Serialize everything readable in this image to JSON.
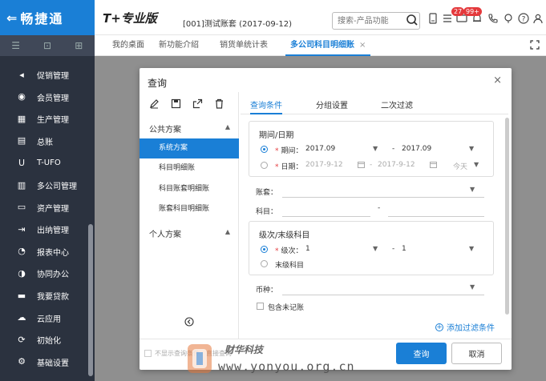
{
  "brand": {
    "glyph": "⇐",
    "name": "畅捷通"
  },
  "product": "T+专业版",
  "account": "[001]测试账套  (2017-09-12)",
  "search": {
    "placeholder": "搜索-产品功能"
  },
  "badges": {
    "messages": "27",
    "notices": "99+"
  },
  "tabs": [
    {
      "label": "我的桌面"
    },
    {
      "label": "新功能介绍"
    },
    {
      "label": "销货单统计表"
    },
    {
      "label": "多公司科目明细账",
      "close": "×"
    }
  ],
  "sidebar": {
    "items": [
      {
        "label": "促销管理",
        "icon": "megaphone-icon"
      },
      {
        "label": "会员管理",
        "icon": "member-icon"
      },
      {
        "label": "生产管理",
        "icon": "production-icon"
      },
      {
        "label": "总账",
        "icon": "ledger-icon"
      },
      {
        "label": "T-UFO",
        "icon": "ufo-icon"
      },
      {
        "label": "多公司管理",
        "icon": "company-icon"
      },
      {
        "label": "资产管理",
        "icon": "asset-icon"
      },
      {
        "label": "出纳管理",
        "icon": "cashier-icon"
      },
      {
        "label": "报表中心",
        "icon": "report-icon"
      },
      {
        "label": "协同办公",
        "icon": "collab-icon"
      },
      {
        "label": "我要贷款",
        "icon": "loan-icon"
      },
      {
        "label": "云应用",
        "icon": "cloud-icon"
      },
      {
        "label": "初始化",
        "icon": "init-icon"
      },
      {
        "label": "基础设置",
        "icon": "settings-icon"
      }
    ]
  },
  "dialog": {
    "title": "查询",
    "close": "×",
    "public_scheme": "公共方案",
    "schemes": [
      "系统方案",
      "科目明细账",
      "科目账套明细账",
      "账套科目明细账"
    ],
    "personal_scheme": "个人方案",
    "tabs": [
      "查询条件",
      "分组设置",
      "二次过滤"
    ],
    "period_section": {
      "title": "期间/日期",
      "period_label": "期间：",
      "period_from": "2017.09",
      "period_to": "2017.09",
      "sep": "-",
      "date_label": "日期：",
      "date_from": "2017-9-12",
      "date_to": "2017-9-12",
      "today": "今天"
    },
    "book_label": "账套：",
    "account_label": "科目：",
    "account_sep": "-",
    "level_section": {
      "title": "级次/末级科目",
      "level_label": "级次：",
      "level_from": "1",
      "level_to": "1",
      "sep": "-",
      "leaf_label": "末级科目"
    },
    "currency_label": "币种：",
    "include_unposted": "包含未记账",
    "add_filter": "添加过滤条件",
    "hide_label": "不显示查询条件，直接查询",
    "ok": "查询",
    "cancel": "取消"
  },
  "watermark": {
    "cn": "财华科技",
    "url": "www.yonyou.org.cn"
  },
  "colors": {
    "accent": "#1a7fd6",
    "sidebar": "#2b323f",
    "required": "#e4393c"
  }
}
